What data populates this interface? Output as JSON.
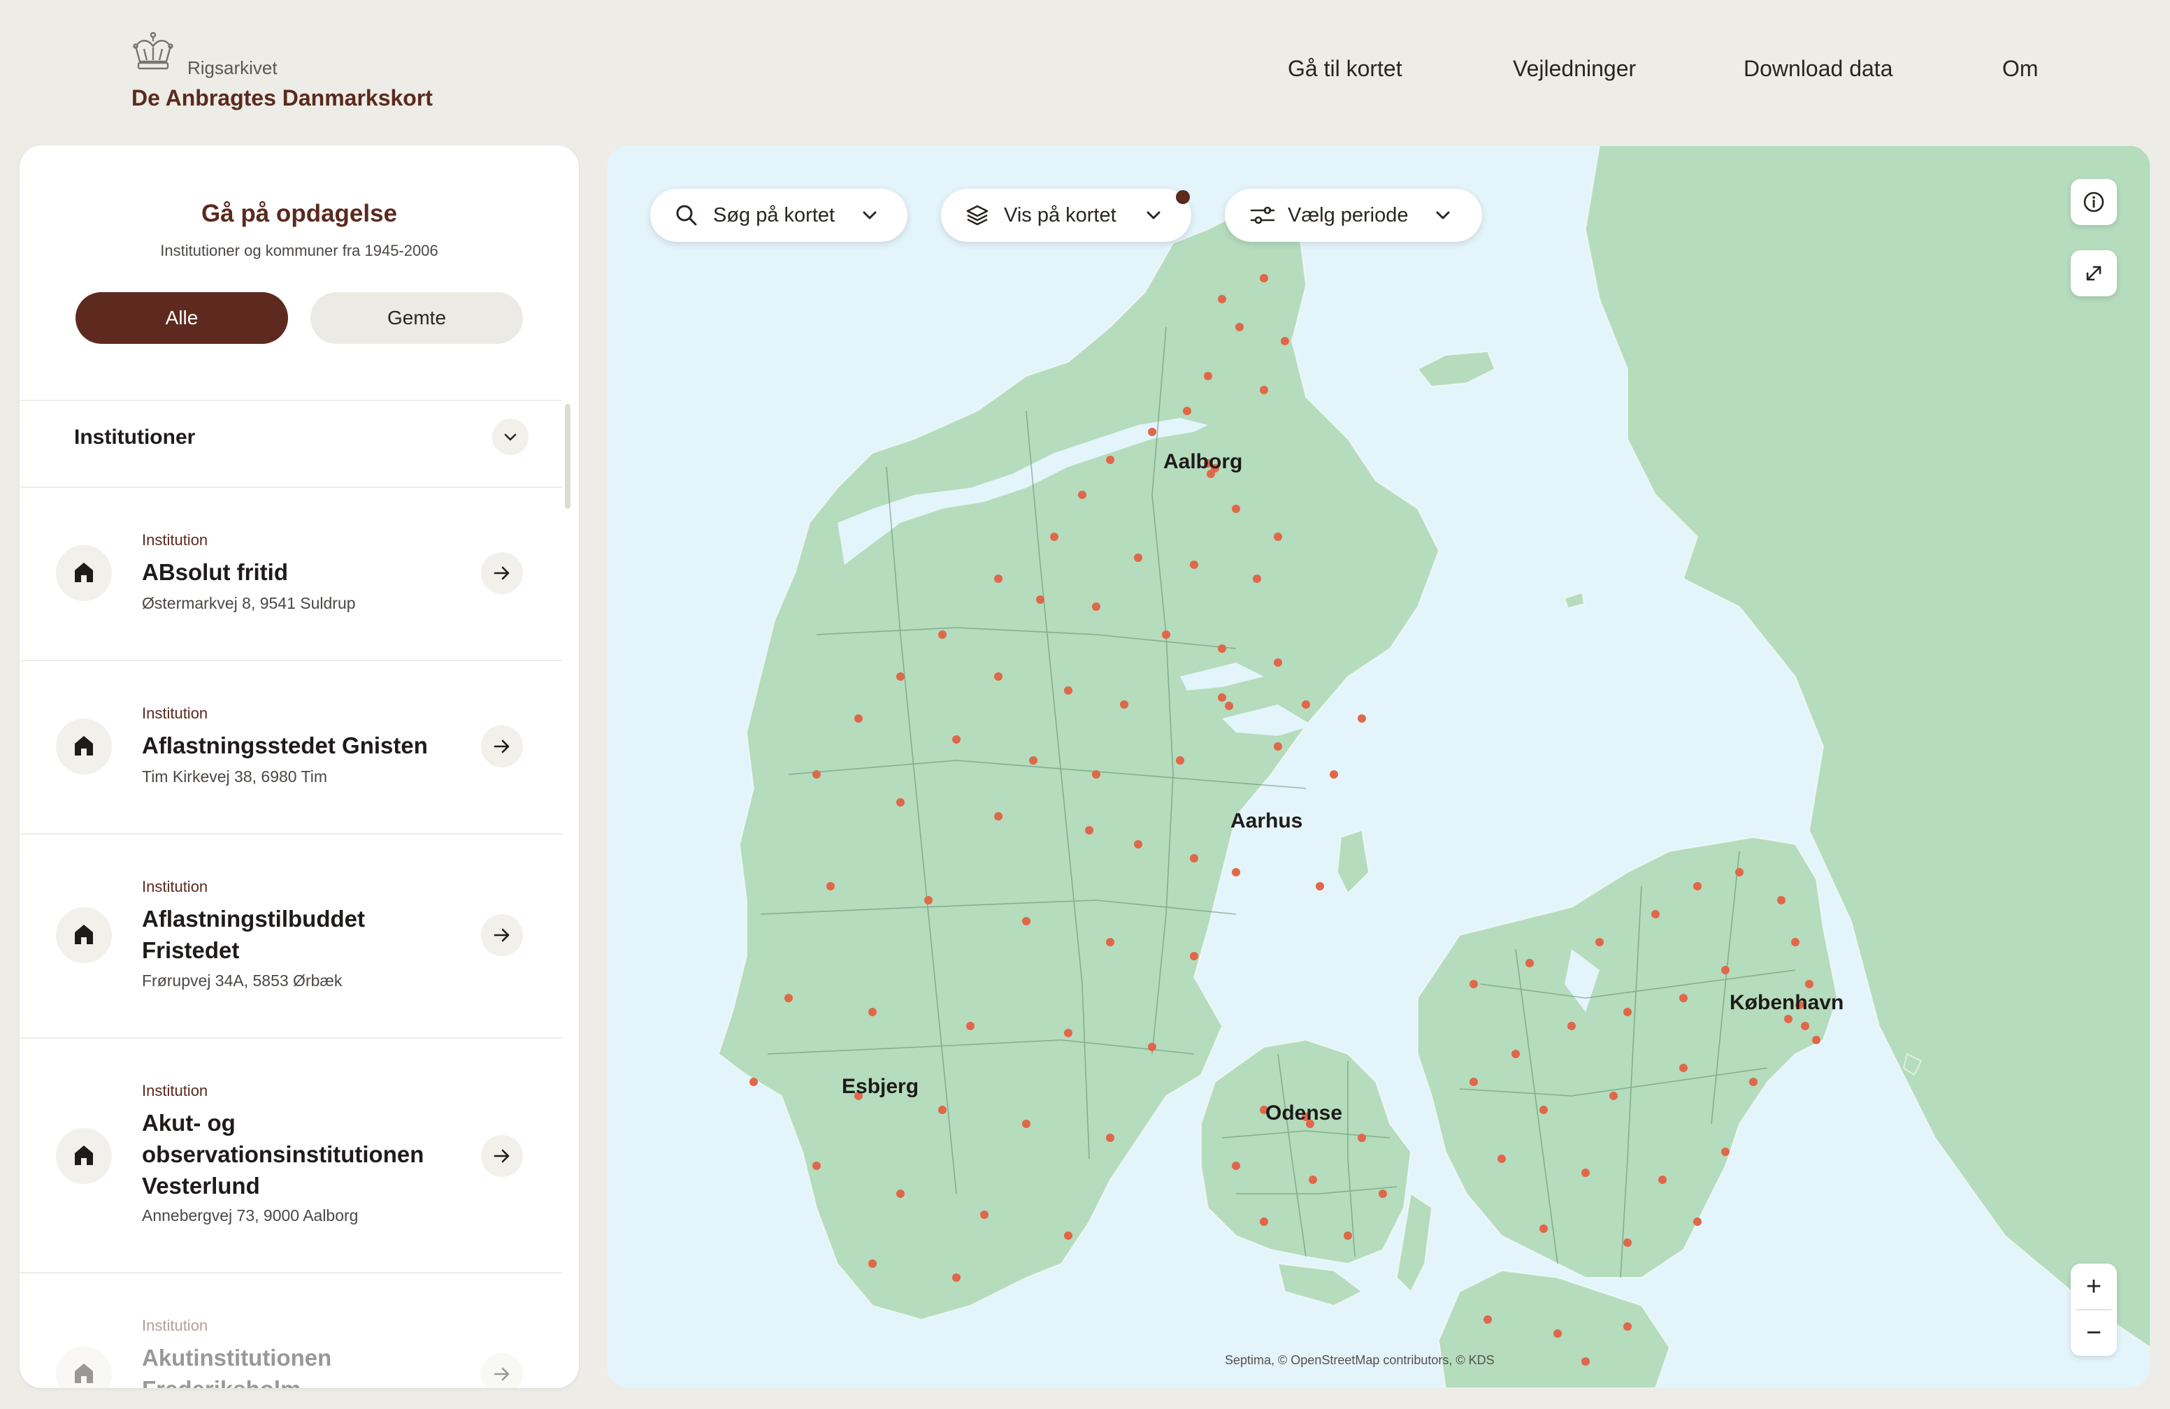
{
  "header": {
    "org_name": "Rigsarkivet",
    "site_title": "De Anbragtes Danmarkskort",
    "nav": [
      "Gå til kortet",
      "Vejledninger",
      "Download data",
      "Om"
    ]
  },
  "sidebar": {
    "title": "Gå på opdagelse",
    "subtitle": "Institutioner og kommuner fra 1945-2006",
    "filters": {
      "all": "Alle",
      "saved": "Gemte",
      "active": "Alle"
    },
    "section_label": "Institutioner",
    "items": [
      {
        "kind": "Institution",
        "name": "ABsolut fritid",
        "address": "Østermarkvej 8, 9541 Suldrup"
      },
      {
        "kind": "Institution",
        "name": "Aflastningsstedet Gnisten",
        "address": "Tim Kirkevej 38, 6980 Tim"
      },
      {
        "kind": "Institution",
        "name": "Aflastningstilbuddet Fristedet",
        "address": "Frørupvej 34A, 5853 Ørbæk"
      },
      {
        "kind": "Institution",
        "name": "Akut- og observationsinstitutionen Vesterlund",
        "address": "Annebergvej 73, 9000 Aalborg"
      },
      {
        "kind": "Institution",
        "name": "Akutinstitutionen Frederiksholm",
        "address": ""
      }
    ]
  },
  "map": {
    "search_label": "Søg på kortet",
    "layers_label": "Vis på kortet",
    "period_label": "Vælg periode",
    "cities": [
      "Aalborg",
      "Aarhus",
      "København",
      "Esbjerg",
      "Odense"
    ],
    "attribution": "Septima, © OpenStreetMap contributors, © KDS",
    "zoom_in": "+",
    "zoom_out": "−",
    "colors": {
      "water": "#e3f4fa",
      "land": "#b5dcbc",
      "marker": "#e0674a",
      "brand": "#5a2a1e"
    }
  }
}
